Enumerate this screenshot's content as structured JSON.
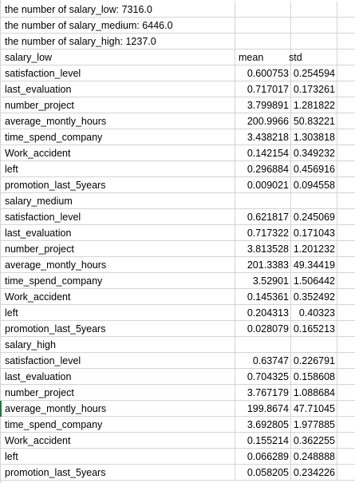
{
  "summary_lines": [
    "the number of salary_low: 7316.0",
    "the number of salary_medium: 6446.0",
    "the number of salary_high: 1237.0"
  ],
  "header": {
    "label": "salary_low",
    "mean": "mean",
    "std": "std"
  },
  "groups": [
    {
      "title": null,
      "rows": [
        {
          "name": "satisfaction_level",
          "mean": "0.600753",
          "std": "0.254594"
        },
        {
          "name": "last_evaluation",
          "mean": "0.717017",
          "std": "0.173261"
        },
        {
          "name": "number_project",
          "mean": "3.799891",
          "std": "1.281822"
        },
        {
          "name": "average_montly_hours",
          "mean": "200.9966",
          "std": "50.83221"
        },
        {
          "name": "time_spend_company",
          "mean": "3.438218",
          "std": "1.303818"
        },
        {
          "name": "Work_accident",
          "mean": "0.142154",
          "std": "0.349232"
        },
        {
          "name": "left",
          "mean": "0.296884",
          "std": "0.456916"
        },
        {
          "name": "promotion_last_5years",
          "mean": "0.009021",
          "std": "0.094558"
        }
      ]
    },
    {
      "title": "salary_medium",
      "rows": [
        {
          "name": "satisfaction_level",
          "mean": "0.621817",
          "std": "0.245069"
        },
        {
          "name": "last_evaluation",
          "mean": "0.717322",
          "std": "0.171043"
        },
        {
          "name": "number_project",
          "mean": "3.813528",
          "std": "1.201232"
        },
        {
          "name": "average_montly_hours",
          "mean": "201.3383",
          "std": "49.34419"
        },
        {
          "name": "time_spend_company",
          "mean": "3.52901",
          "std": "1.506442"
        },
        {
          "name": "Work_accident",
          "mean": "0.145361",
          "std": "0.352492"
        },
        {
          "name": "left",
          "mean": "0.204313",
          "std": "0.40323"
        },
        {
          "name": "promotion_last_5years",
          "mean": "0.028079",
          "std": "0.165213"
        }
      ]
    },
    {
      "title": "salary_high",
      "rows": [
        {
          "name": "satisfaction_level",
          "mean": "0.63747",
          "std": "0.226791"
        },
        {
          "name": "last_evaluation",
          "mean": "0.704325",
          "std": "0.158608"
        },
        {
          "name": "number_project",
          "mean": "3.767179",
          "std": "1.088684"
        },
        {
          "name": "average_montly_hours",
          "mean": "199.8674",
          "std": "47.71045"
        },
        {
          "name": "time_spend_company",
          "mean": "3.692805",
          "std": "1.977885"
        },
        {
          "name": "Work_accident",
          "mean": "0.155214",
          "std": "0.362255"
        },
        {
          "name": "left",
          "mean": "0.066289",
          "std": "0.248888"
        },
        {
          "name": "promotion_last_5years",
          "mean": "0.058205",
          "std": "0.234226"
        }
      ]
    }
  ]
}
